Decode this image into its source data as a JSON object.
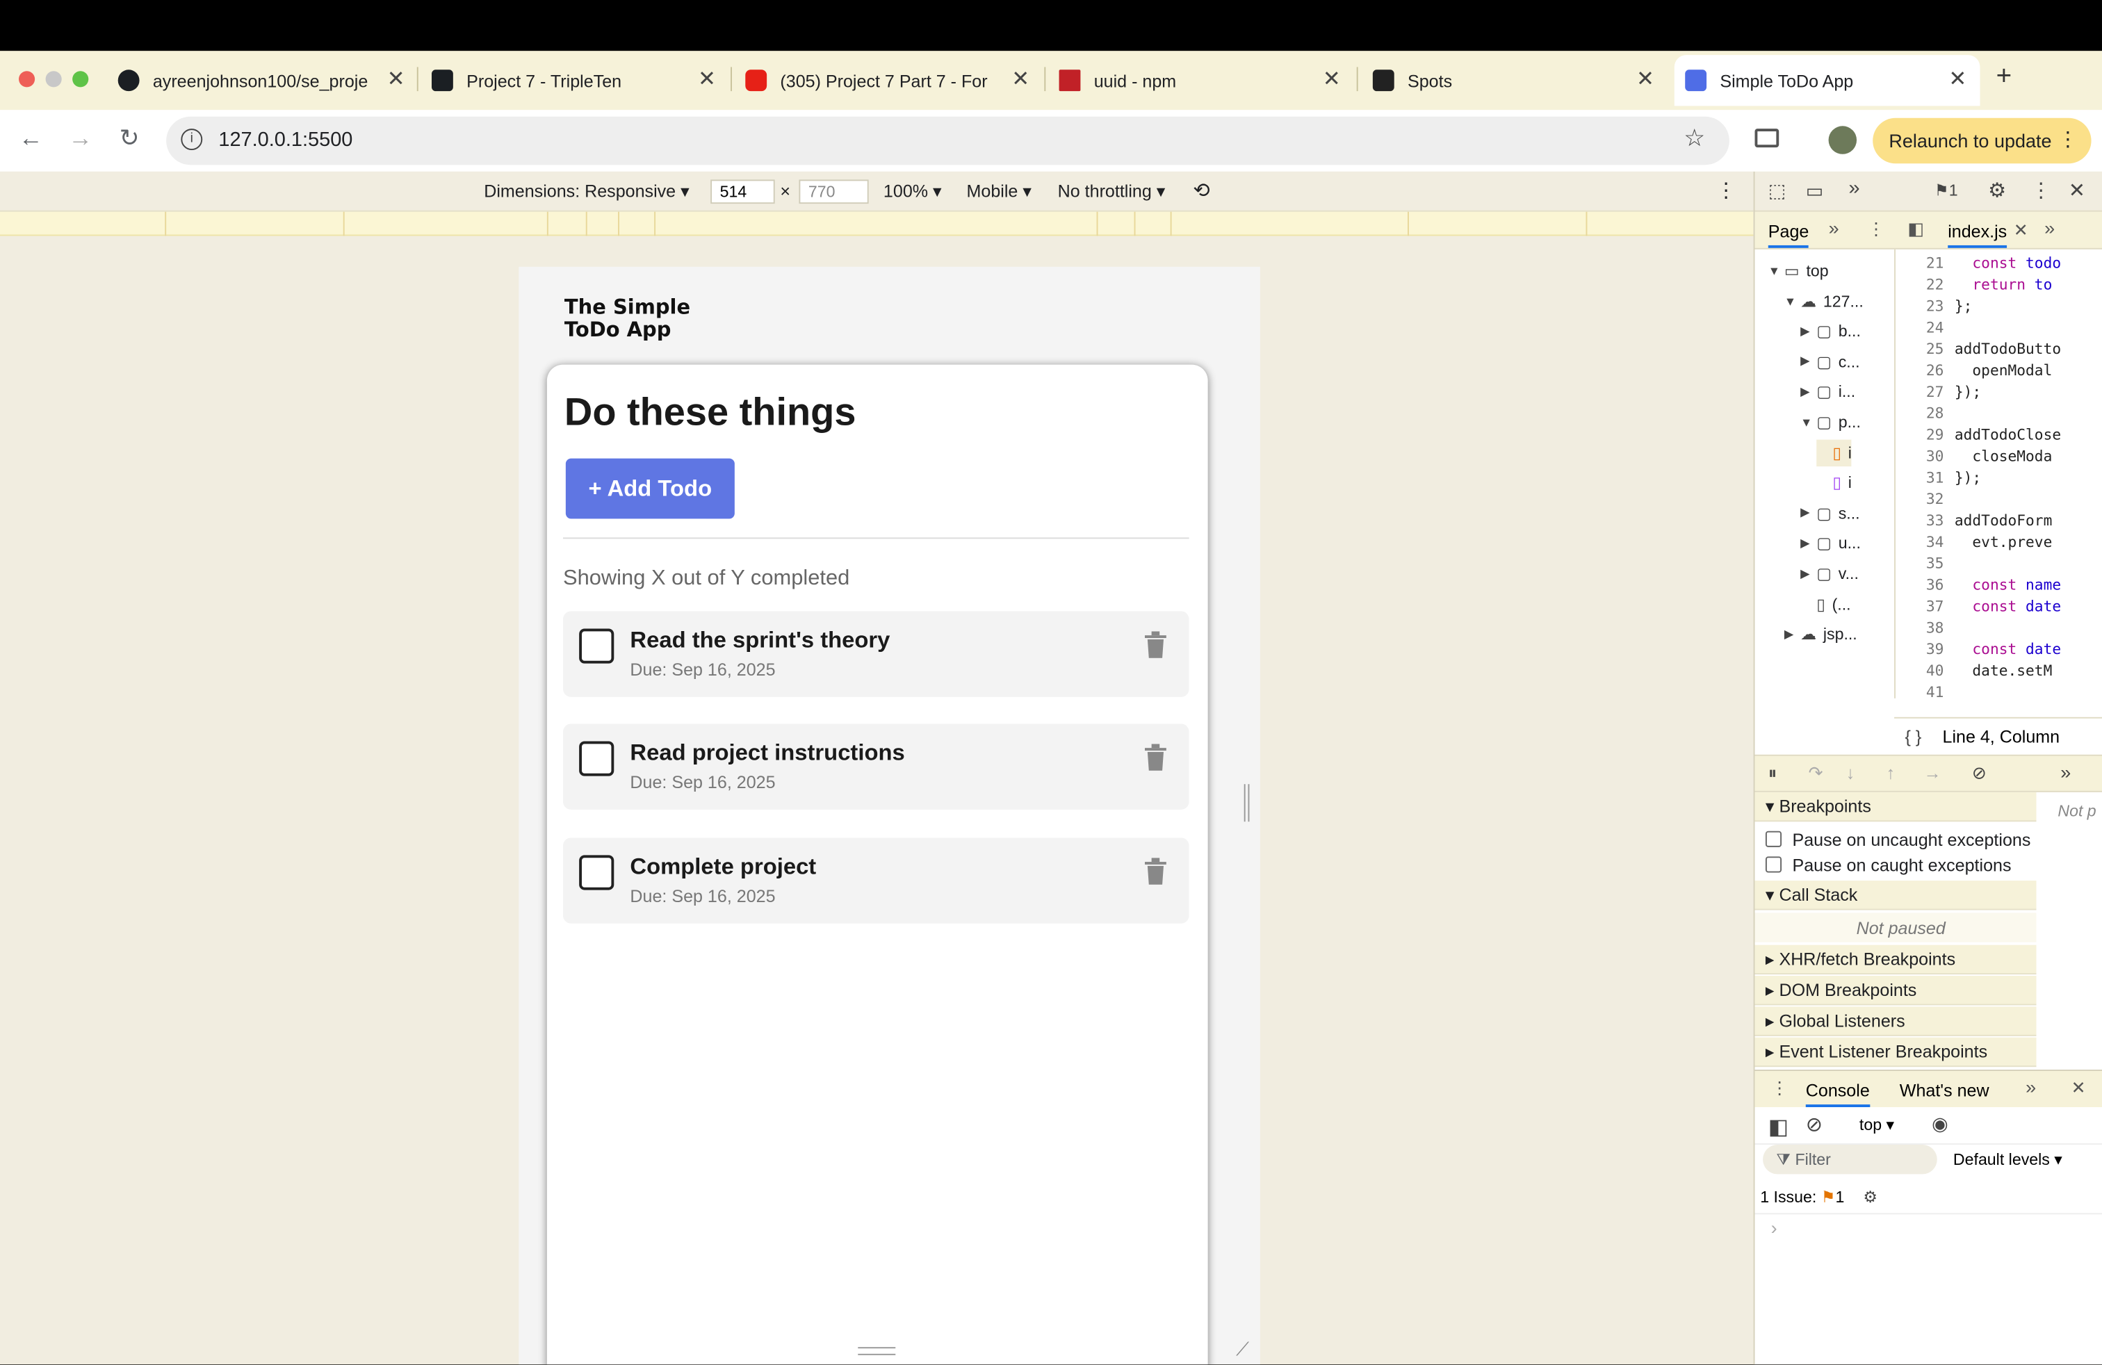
{
  "browser": {
    "tabs": [
      {
        "title": "ayreenjohnson100/se_proje",
        "favicon": "github-icon"
      },
      {
        "title": "Project 7 - TripleTen",
        "favicon": "tripleten-icon"
      },
      {
        "title": "(305) Project 7 Part 7 - For",
        "favicon": "youtube-icon"
      },
      {
        "title": "uuid - npm",
        "favicon": "npm-icon"
      },
      {
        "title": "Spots",
        "favicon": "spots-icon"
      },
      {
        "title": "Simple ToDo App",
        "favicon": "checkbox-icon"
      }
    ],
    "new_tab": "+",
    "url": "127.0.0.1:5500",
    "relaunch": "Relaunch to update"
  },
  "device_toolbar": {
    "dimensions": "Dimensions: Responsive",
    "width": "514",
    "times": "×",
    "height": "770",
    "zoom": "100%",
    "device_type": "Mobile",
    "throttling": "No throttling"
  },
  "app": {
    "brand": "The Simple ToDo App",
    "heading": "Do these things",
    "add_button": "+ Add Todo",
    "counter": "Showing X out of Y completed",
    "todos": [
      {
        "name": "Read the sprint's theory",
        "due": "Due: Sep 16, 2025",
        "completed": false
      },
      {
        "name": "Read project instructions",
        "due": "Due: Sep 16, 2025",
        "completed": false
      },
      {
        "name": "Complete project",
        "due": "Due: Sep 16, 2025",
        "completed": false
      }
    ]
  },
  "devtools": {
    "issues_count": "1",
    "nav_tab": "Page",
    "file_tab": "index.js",
    "tree": [
      {
        "label": "top",
        "indent": 0,
        "type": "frame",
        "open": true
      },
      {
        "label": "127...",
        "indent": 1,
        "type": "cloud",
        "open": true
      },
      {
        "label": "b...",
        "indent": 2,
        "type": "folder",
        "open": false
      },
      {
        "label": "c...",
        "indent": 2,
        "type": "folder",
        "open": false
      },
      {
        "label": "i...",
        "indent": 2,
        "type": "folder",
        "open": false
      },
      {
        "label": "p...",
        "indent": 2,
        "type": "folder",
        "open": true
      },
      {
        "label": "i",
        "indent": 3,
        "type": "file-js"
      },
      {
        "label": "i",
        "indent": 3,
        "type": "file-css"
      },
      {
        "label": "s...",
        "indent": 2,
        "type": "folder",
        "open": false
      },
      {
        "label": "u...",
        "indent": 2,
        "type": "folder",
        "open": false
      },
      {
        "label": "v...",
        "indent": 2,
        "type": "folder",
        "open": false
      },
      {
        "label": "(...",
        "indent": 2,
        "type": "file"
      },
      {
        "label": "jsp...",
        "indent": 1,
        "type": "cloud",
        "open": false
      }
    ],
    "code_lines": [
      {
        "n": "21",
        "kw": "const",
        "rest": " todo"
      },
      {
        "n": "22",
        "kw": "return",
        "rest": " to"
      },
      {
        "n": "23",
        "kw": "",
        "rest": "};"
      },
      {
        "n": "24",
        "kw": "",
        "rest": ""
      },
      {
        "n": "25",
        "kw": "",
        "rest": "addTodoButto"
      },
      {
        "n": "26",
        "kw": "",
        "rest": "  openModal"
      },
      {
        "n": "27",
        "kw": "",
        "rest": "});"
      },
      {
        "n": "28",
        "kw": "",
        "rest": ""
      },
      {
        "n": "29",
        "kw": "",
        "rest": "addTodoClose"
      },
      {
        "n": "30",
        "kw": "",
        "rest": "  closeModa"
      },
      {
        "n": "31",
        "kw": "",
        "rest": "});"
      },
      {
        "n": "32",
        "kw": "",
        "rest": ""
      },
      {
        "n": "33",
        "kw": "",
        "rest": "addTodoForm"
      },
      {
        "n": "34",
        "kw": "",
        "rest": "  evt.preve"
      },
      {
        "n": "35",
        "kw": "",
        "rest": ""
      },
      {
        "n": "36",
        "kw": "const",
        "rest": " name"
      },
      {
        "n": "37",
        "kw": "const",
        "rest": " date"
      },
      {
        "n": "38",
        "kw": "",
        "rest": ""
      },
      {
        "n": "39",
        "kw": "const",
        "rest": " date"
      },
      {
        "n": "40",
        "kw": "",
        "rest": "  date.setM"
      },
      {
        "n": "41",
        "kw": "",
        "rest": ""
      }
    ],
    "status": "Line 4, Column",
    "breakpoints": {
      "section": "Breakpoints",
      "uncaught": "Pause on uncaught exceptions",
      "caught": "Pause on caught exceptions",
      "call_stack": "Call Stack",
      "not_paused": "Not paused",
      "xhr": "XHR/fetch Breakpoints",
      "dom": "DOM Breakpoints",
      "global": "Global Listeners",
      "event": "Event Listener Breakpoints",
      "scope_hint": "Not p"
    },
    "console": {
      "tab": "Console",
      "whats_new": "What's new",
      "context": "top",
      "filter": "Filter",
      "levels": "Default levels",
      "issues_label": "1 Issue:",
      "issues_n": "1",
      "prompt": "›"
    }
  }
}
